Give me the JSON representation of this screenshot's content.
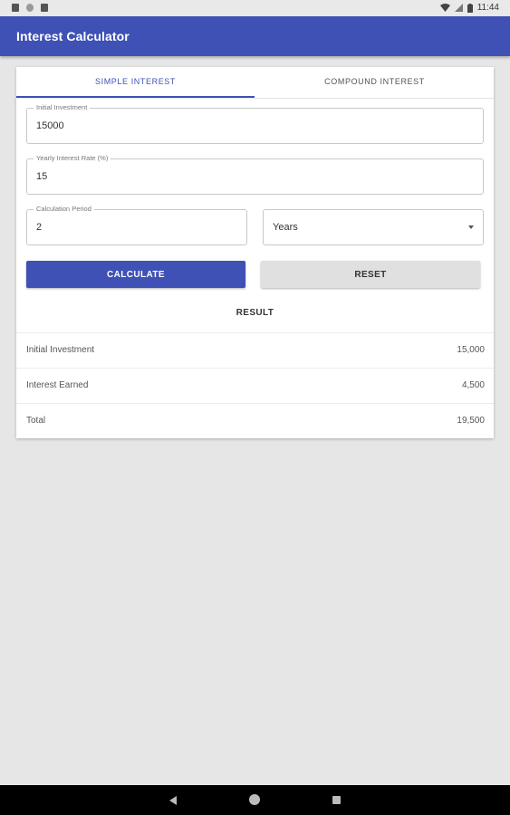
{
  "status_bar": {
    "time": "11:44",
    "icons": [
      "notification-icon",
      "sync-icon",
      "sd-card-icon",
      "wifi-icon",
      "signal-icon",
      "battery-icon"
    ]
  },
  "app_bar": {
    "title": "Interest Calculator",
    "color": "#3f51b5"
  },
  "tabs": [
    {
      "label": "SIMPLE INTEREST",
      "active": true
    },
    {
      "label": "COMPOUND INTEREST",
      "active": false
    }
  ],
  "form": {
    "initial_investment": {
      "label": "Initial Investment",
      "value": "15000"
    },
    "interest_rate": {
      "label": "Yearly Interest Rate (%)",
      "value": "15"
    },
    "period": {
      "label": "Calculation Period",
      "value": "2"
    },
    "period_unit": {
      "selected": "Years"
    }
  },
  "buttons": {
    "calculate": "CALCULATE",
    "reset": "RESET"
  },
  "result": {
    "title": "RESULT",
    "rows": [
      {
        "label": "Initial Investment",
        "value": "15,000"
      },
      {
        "label": "Interest Earned",
        "value": "4,500"
      },
      {
        "label": "Total",
        "value": "19,500"
      }
    ]
  }
}
